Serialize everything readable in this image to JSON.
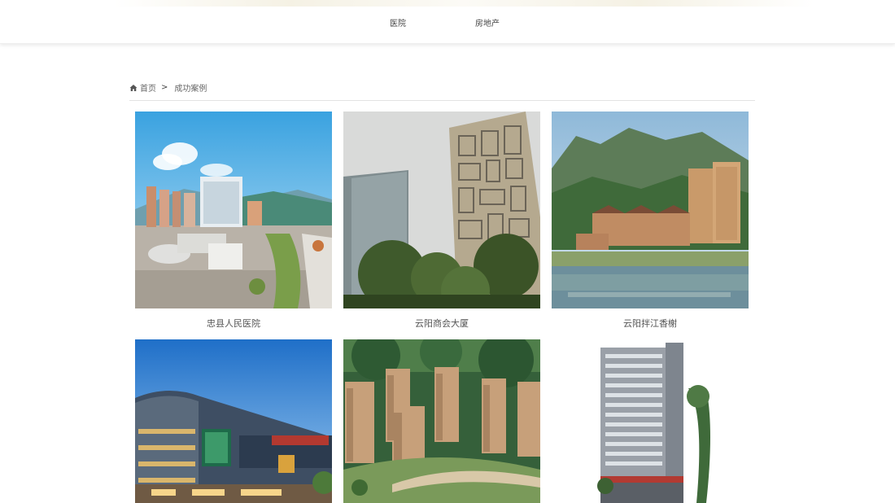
{
  "nav": {
    "items": [
      {
        "label": "医院"
      },
      {
        "label": "房地产"
      }
    ]
  },
  "breadcrumb": {
    "home": "首页",
    "separator": ">",
    "current": "成功案例"
  },
  "cases": [
    {
      "caption": "忠县人民医院"
    },
    {
      "caption": "云阳商会大厦"
    },
    {
      "caption": "云阳拌江香榭"
    },
    {
      "caption": ""
    },
    {
      "caption": ""
    },
    {
      "caption": ""
    }
  ]
}
